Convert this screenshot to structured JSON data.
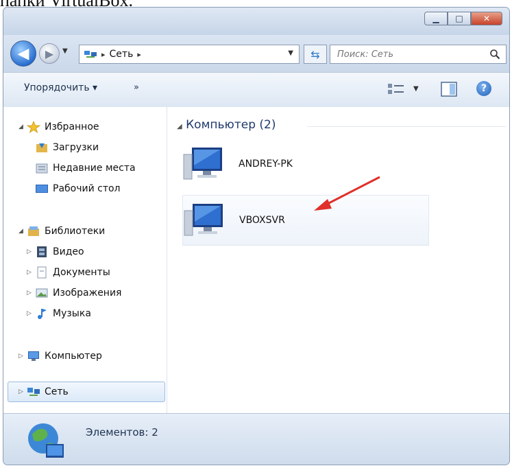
{
  "document_text": "папки VirtualBox.",
  "window": {
    "caption_buttons": [
      "minimize",
      "maximize",
      "close"
    ]
  },
  "navigation": {
    "address": {
      "crumb": "Сеть",
      "separator": "▸"
    },
    "search": {
      "placeholder": "Поиск: Сеть"
    }
  },
  "toolbar": {
    "organize_label": "Упорядочить ▾",
    "more_label": "»"
  },
  "sidebar": {
    "favorites": {
      "label": "Избранное",
      "items": [
        "Загрузки",
        "Недавние места",
        "Рабочий стол"
      ]
    },
    "libraries": {
      "label": "Библиотеки",
      "items": [
        "Видео",
        "Документы",
        "Изображения",
        "Музыка"
      ]
    },
    "computer": {
      "label": "Компьютер"
    },
    "network": {
      "label": "Сеть",
      "selected": true
    }
  },
  "content": {
    "group_header": "Компьютер (2)",
    "items": [
      {
        "label": "ANDREY-PK",
        "icon": "computer-icon"
      },
      {
        "label": "VBOXSVR",
        "icon": "computer-icon",
        "highlighted": true
      }
    ]
  },
  "status": {
    "text": "Элементов: 2"
  },
  "colors": {
    "accent": "#2a6fd0",
    "annotation_arrow": "#e0302a",
    "header_text": "#1e3a6e"
  }
}
